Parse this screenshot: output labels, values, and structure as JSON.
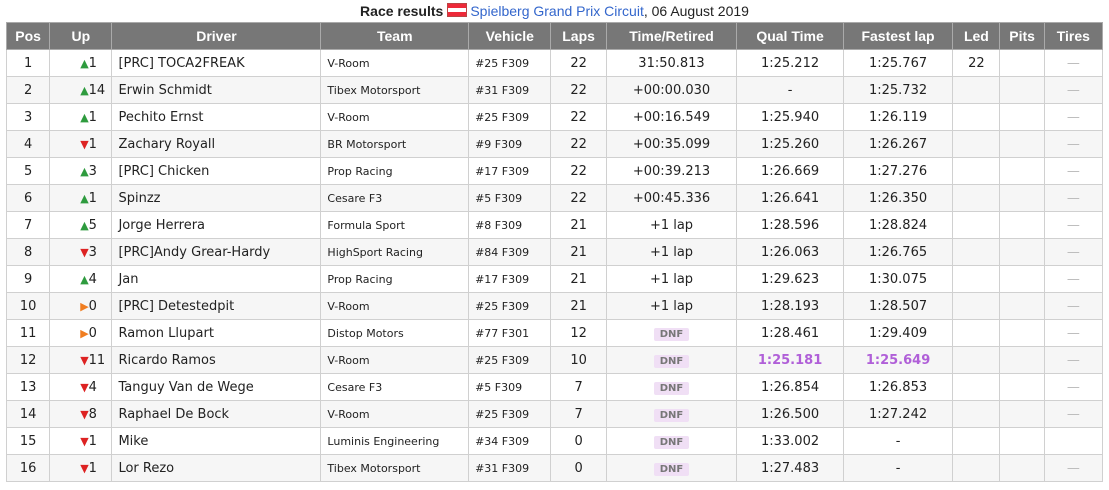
{
  "caption": {
    "label": "Race results",
    "circuit": "Spielberg Grand Prix Circuit",
    "date": ", 06 August 2019"
  },
  "headers": [
    "Pos",
    "Up",
    "Driver",
    "Team",
    "Vehicle",
    "Laps",
    "Time/Retired",
    "Qual Time",
    "Fastest lap",
    "Led",
    "Pits",
    "Tires"
  ],
  "rows": [
    {
      "pos": "1",
      "dir": "up",
      "up": "1",
      "driver": "[PRC] TOCA2FREAK",
      "team": "V-Room",
      "vehicle": "#25 F309",
      "laps": "22",
      "time": "31:50.813",
      "dnf": false,
      "qual": "1:25.212",
      "qual_best": false,
      "fast": "1:25.767",
      "fast_best": false,
      "led": "22",
      "pits": "",
      "tires": "—"
    },
    {
      "pos": "2",
      "dir": "up",
      "up": "14",
      "driver": "Erwin Schmidt",
      "team": "Tibex Motorsport",
      "vehicle": "#31 F309",
      "laps": "22",
      "time": "+00:00.030",
      "dnf": false,
      "qual": "-",
      "qual_best": false,
      "fast": "1:25.732",
      "fast_best": false,
      "led": "",
      "pits": "",
      "tires": "—"
    },
    {
      "pos": "3",
      "dir": "up",
      "up": "1",
      "driver": "Pechito Ernst",
      "team": "V-Room",
      "vehicle": "#25 F309",
      "laps": "22",
      "time": "+00:16.549",
      "dnf": false,
      "qual": "1:25.940",
      "qual_best": false,
      "fast": "1:26.119",
      "fast_best": false,
      "led": "",
      "pits": "",
      "tires": "—"
    },
    {
      "pos": "4",
      "dir": "down",
      "up": "1",
      "driver": "Zachary Royall",
      "team": "BR Motorsport",
      "vehicle": "#9 F309",
      "laps": "22",
      "time": "+00:35.099",
      "dnf": false,
      "qual": "1:25.260",
      "qual_best": false,
      "fast": "1:26.267",
      "fast_best": false,
      "led": "",
      "pits": "",
      "tires": "—"
    },
    {
      "pos": "5",
      "dir": "up",
      "up": "3",
      "driver": "[PRC] Chicken",
      "team": "Prop Racing",
      "vehicle": "#17 F309",
      "laps": "22",
      "time": "+00:39.213",
      "dnf": false,
      "qual": "1:26.669",
      "qual_best": false,
      "fast": "1:27.276",
      "fast_best": false,
      "led": "",
      "pits": "",
      "tires": "—"
    },
    {
      "pos": "6",
      "dir": "up",
      "up": "1",
      "driver": "Spinzz",
      "team": "Cesare F3",
      "vehicle": "#5 F309",
      "laps": "22",
      "time": "+00:45.336",
      "dnf": false,
      "qual": "1:26.641",
      "qual_best": false,
      "fast": "1:26.350",
      "fast_best": false,
      "led": "",
      "pits": "",
      "tires": "—"
    },
    {
      "pos": "7",
      "dir": "up",
      "up": "5",
      "driver": "Jorge Herrera",
      "team": "Formula Sport",
      "vehicle": "#8 F309",
      "laps": "21",
      "time": "+1 lap",
      "dnf": false,
      "qual": "1:28.596",
      "qual_best": false,
      "fast": "1:28.824",
      "fast_best": false,
      "led": "",
      "pits": "",
      "tires": "—"
    },
    {
      "pos": "8",
      "dir": "down",
      "up": "3",
      "driver": "[PRC]Andy Grear-Hardy",
      "team": "HighSport Racing",
      "vehicle": "#84 F309",
      "laps": "21",
      "time": "+1 lap",
      "dnf": false,
      "qual": "1:26.063",
      "qual_best": false,
      "fast": "1:26.765",
      "fast_best": false,
      "led": "",
      "pits": "",
      "tires": "—"
    },
    {
      "pos": "9",
      "dir": "up",
      "up": "4",
      "driver": "Jan",
      "team": "Prop Racing",
      "vehicle": "#17 F309",
      "laps": "21",
      "time": "+1 lap",
      "dnf": false,
      "qual": "1:29.623",
      "qual_best": false,
      "fast": "1:30.075",
      "fast_best": false,
      "led": "",
      "pits": "",
      "tires": "—"
    },
    {
      "pos": "10",
      "dir": "eq",
      "up": "0",
      "driver": "[PRC] Detestedpit",
      "team": "V-Room",
      "vehicle": "#25 F309",
      "laps": "21",
      "time": "+1 lap",
      "dnf": false,
      "qual": "1:28.193",
      "qual_best": false,
      "fast": "1:28.507",
      "fast_best": false,
      "led": "",
      "pits": "",
      "tires": "—"
    },
    {
      "pos": "11",
      "dir": "eq",
      "up": "0",
      "driver": "Ramon Llupart",
      "team": "Distop Motors",
      "vehicle": "#77 F301",
      "laps": "12",
      "time": "DNF",
      "dnf": true,
      "qual": "1:28.461",
      "qual_best": false,
      "fast": "1:29.409",
      "fast_best": false,
      "led": "",
      "pits": "",
      "tires": "—"
    },
    {
      "pos": "12",
      "dir": "down",
      "up": "11",
      "driver": "Ricardo Ramos",
      "team": "V-Room",
      "vehicle": "#25 F309",
      "laps": "10",
      "time": "DNF",
      "dnf": true,
      "qual": "1:25.181",
      "qual_best": true,
      "fast": "1:25.649",
      "fast_best": true,
      "led": "",
      "pits": "",
      "tires": "—"
    },
    {
      "pos": "13",
      "dir": "down",
      "up": "4",
      "driver": "Tanguy Van de Wege",
      "team": "Cesare F3",
      "vehicle": "#5 F309",
      "laps": "7",
      "time": "DNF",
      "dnf": true,
      "qual": "1:26.854",
      "qual_best": false,
      "fast": "1:26.853",
      "fast_best": false,
      "led": "",
      "pits": "",
      "tires": "—"
    },
    {
      "pos": "14",
      "dir": "down",
      "up": "8",
      "driver": "Raphael De Bock",
      "team": "V-Room",
      "vehicle": "#25 F309",
      "laps": "7",
      "time": "DNF",
      "dnf": true,
      "qual": "1:26.500",
      "qual_best": false,
      "fast": "1:27.242",
      "fast_best": false,
      "led": "",
      "pits": "",
      "tires": "—"
    },
    {
      "pos": "15",
      "dir": "down",
      "up": "1",
      "driver": "Mike",
      "team": "Luminis Engineering",
      "vehicle": "#34 F309",
      "laps": "0",
      "time": "DNF",
      "dnf": true,
      "qual": "1:33.002",
      "qual_best": false,
      "fast": "-",
      "fast_best": false,
      "led": "",
      "pits": "",
      "tires": ""
    },
    {
      "pos": "16",
      "dir": "down",
      "up": "1",
      "driver": "Lor Rezo",
      "team": "Tibex Motorsport",
      "vehicle": "#31 F309",
      "laps": "0",
      "time": "DNF",
      "dnf": true,
      "qual": "1:27.483",
      "qual_best": false,
      "fast": "-",
      "fast_best": false,
      "led": "",
      "pits": "",
      "tires": "—"
    }
  ],
  "colors": {
    "header_bg": "#777777",
    "up": "#2e9b3e",
    "down": "#dd2222",
    "same": "#f07d20",
    "best_lap": "#b05fd8",
    "dnf_bg": "#f0dff5",
    "link": "#3366cc"
  },
  "icons": {
    "up": "triangle-up-icon",
    "down": "triangle-down-icon",
    "same": "triangle-right-icon",
    "flag": "austria-flag-icon"
  }
}
